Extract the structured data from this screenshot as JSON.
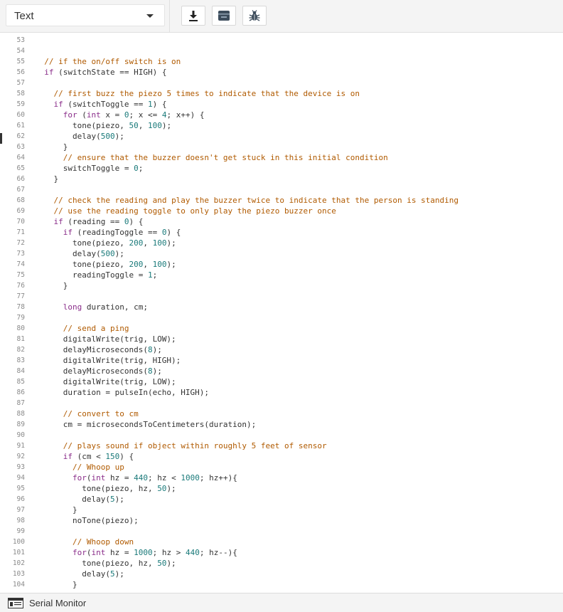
{
  "toolbar": {
    "mode_label": "Text",
    "icons": [
      "download-icon",
      "archive-icon",
      "bug-icon"
    ]
  },
  "colors": {
    "keyword": "#8a2d8a",
    "number": "#1a7a7a",
    "comment": "#b05a00",
    "text": "#333333",
    "gutter": "#8a8a8a"
  },
  "editor": {
    "first_visible_line": 53,
    "lines": [
      {
        "n": "53",
        "segs": []
      },
      {
        "n": "54",
        "segs": []
      },
      {
        "n": "55",
        "segs": [
          {
            "t": "  "
          },
          {
            "t": "// if the on/off switch is on",
            "c": "cm"
          }
        ]
      },
      {
        "n": "56",
        "segs": [
          {
            "t": "  "
          },
          {
            "t": "if",
            "c": "kw"
          },
          {
            "t": " (switchState == HIGH) {"
          }
        ]
      },
      {
        "n": "57",
        "segs": []
      },
      {
        "n": "58",
        "segs": [
          {
            "t": "    "
          },
          {
            "t": "// first buzz the piezo 5 times to indicate that the device is on",
            "c": "cm"
          }
        ]
      },
      {
        "n": "59",
        "segs": [
          {
            "t": "    "
          },
          {
            "t": "if",
            "c": "kw"
          },
          {
            "t": " (switchToggle == "
          },
          {
            "t": "1",
            "c": "num"
          },
          {
            "t": ") {"
          }
        ]
      },
      {
        "n": "60",
        "segs": [
          {
            "t": "      "
          },
          {
            "t": "for",
            "c": "kw"
          },
          {
            "t": " ("
          },
          {
            "t": "int",
            "c": "kw"
          },
          {
            "t": " x = "
          },
          {
            "t": "0",
            "c": "num"
          },
          {
            "t": "; x <= "
          },
          {
            "t": "4",
            "c": "num"
          },
          {
            "t": "; x++) {"
          }
        ]
      },
      {
        "n": "61",
        "segs": [
          {
            "t": "        tone(piezo, "
          },
          {
            "t": "50",
            "c": "num"
          },
          {
            "t": ", "
          },
          {
            "t": "100",
            "c": "num"
          },
          {
            "t": ");"
          }
        ]
      },
      {
        "n": "62",
        "segs": [
          {
            "t": "        delay("
          },
          {
            "t": "500",
            "c": "num"
          },
          {
            "t": ");"
          }
        ]
      },
      {
        "n": "63",
        "segs": [
          {
            "t": "      }"
          }
        ]
      },
      {
        "n": "64",
        "segs": [
          {
            "t": "      "
          },
          {
            "t": "// ensure that the buzzer doesn't get stuck in this initial condition",
            "c": "cm"
          }
        ]
      },
      {
        "n": "65",
        "segs": [
          {
            "t": "      switchToggle = "
          },
          {
            "t": "0",
            "c": "num"
          },
          {
            "t": ";"
          }
        ]
      },
      {
        "n": "66",
        "segs": [
          {
            "t": "    }"
          }
        ]
      },
      {
        "n": "67",
        "segs": []
      },
      {
        "n": "68",
        "segs": [
          {
            "t": "    "
          },
          {
            "t": "// check the reading and play the buzzer twice to indicate that the person is standing",
            "c": "cm"
          }
        ]
      },
      {
        "n": "69",
        "segs": [
          {
            "t": "    "
          },
          {
            "t": "// use the reading toggle to only play the piezo buzzer once",
            "c": "cm"
          }
        ]
      },
      {
        "n": "70",
        "segs": [
          {
            "t": "    "
          },
          {
            "t": "if",
            "c": "kw"
          },
          {
            "t": " (reading == "
          },
          {
            "t": "0",
            "c": "num"
          },
          {
            "t": ") {"
          }
        ]
      },
      {
        "n": "71",
        "segs": [
          {
            "t": "      "
          },
          {
            "t": "if",
            "c": "kw"
          },
          {
            "t": " (readingToggle == "
          },
          {
            "t": "0",
            "c": "num"
          },
          {
            "t": ") {"
          }
        ]
      },
      {
        "n": "72",
        "segs": [
          {
            "t": "        tone(piezo, "
          },
          {
            "t": "200",
            "c": "num"
          },
          {
            "t": ", "
          },
          {
            "t": "100",
            "c": "num"
          },
          {
            "t": ");"
          }
        ]
      },
      {
        "n": "73",
        "segs": [
          {
            "t": "        delay("
          },
          {
            "t": "500",
            "c": "num"
          },
          {
            "t": ");"
          }
        ]
      },
      {
        "n": "74",
        "segs": [
          {
            "t": "        tone(piezo, "
          },
          {
            "t": "200",
            "c": "num"
          },
          {
            "t": ", "
          },
          {
            "t": "100",
            "c": "num"
          },
          {
            "t": ");"
          }
        ]
      },
      {
        "n": "75",
        "segs": [
          {
            "t": "        readingToggle = "
          },
          {
            "t": "1",
            "c": "num"
          },
          {
            "t": ";"
          }
        ]
      },
      {
        "n": "76",
        "segs": [
          {
            "t": "      }"
          }
        ]
      },
      {
        "n": "77",
        "segs": []
      },
      {
        "n": "78",
        "segs": [
          {
            "t": "      "
          },
          {
            "t": "long",
            "c": "kw"
          },
          {
            "t": " duration, cm;"
          }
        ]
      },
      {
        "n": "79",
        "segs": []
      },
      {
        "n": "80",
        "segs": [
          {
            "t": "      "
          },
          {
            "t": "// send a ping",
            "c": "cm"
          }
        ]
      },
      {
        "n": "81",
        "segs": [
          {
            "t": "      digitalWrite(trig, LOW);"
          }
        ]
      },
      {
        "n": "82",
        "segs": [
          {
            "t": "      delayMicroseconds("
          },
          {
            "t": "8",
            "c": "num"
          },
          {
            "t": ");"
          }
        ]
      },
      {
        "n": "83",
        "segs": [
          {
            "t": "      digitalWrite(trig, HIGH);"
          }
        ]
      },
      {
        "n": "84",
        "segs": [
          {
            "t": "      delayMicroseconds("
          },
          {
            "t": "8",
            "c": "num"
          },
          {
            "t": ");"
          }
        ]
      },
      {
        "n": "85",
        "segs": [
          {
            "t": "      digitalWrite(trig, LOW);"
          }
        ]
      },
      {
        "n": "86",
        "segs": [
          {
            "t": "      duration = pulseIn(echo, HIGH);"
          }
        ]
      },
      {
        "n": "87",
        "segs": []
      },
      {
        "n": "88",
        "segs": [
          {
            "t": "      "
          },
          {
            "t": "// convert to cm",
            "c": "cm"
          }
        ]
      },
      {
        "n": "89",
        "segs": [
          {
            "t": "      cm = microsecondsToCentimeters(duration);"
          }
        ]
      },
      {
        "n": "90",
        "segs": []
      },
      {
        "n": "91",
        "segs": [
          {
            "t": "      "
          },
          {
            "t": "// plays sound if object within roughly 5 feet of sensor",
            "c": "cm"
          }
        ]
      },
      {
        "n": "92",
        "segs": [
          {
            "t": "      "
          },
          {
            "t": "if",
            "c": "kw"
          },
          {
            "t": " (cm < "
          },
          {
            "t": "150",
            "c": "num"
          },
          {
            "t": ") {"
          }
        ]
      },
      {
        "n": "93",
        "segs": [
          {
            "t": "        "
          },
          {
            "t": "// Whoop up",
            "c": "cm"
          }
        ]
      },
      {
        "n": "94",
        "segs": [
          {
            "t": "        "
          },
          {
            "t": "for",
            "c": "kw"
          },
          {
            "t": "("
          },
          {
            "t": "int",
            "c": "kw"
          },
          {
            "t": " hz = "
          },
          {
            "t": "440",
            "c": "num"
          },
          {
            "t": "; hz < "
          },
          {
            "t": "1000",
            "c": "num"
          },
          {
            "t": "; hz++){"
          }
        ]
      },
      {
        "n": "95",
        "segs": [
          {
            "t": "          tone(piezo, hz, "
          },
          {
            "t": "50",
            "c": "num"
          },
          {
            "t": ");"
          }
        ]
      },
      {
        "n": "96",
        "segs": [
          {
            "t": "          delay("
          },
          {
            "t": "5",
            "c": "num"
          },
          {
            "t": ");"
          }
        ]
      },
      {
        "n": "97",
        "segs": [
          {
            "t": "        }"
          }
        ]
      },
      {
        "n": "98",
        "segs": [
          {
            "t": "        noTone(piezo);"
          }
        ]
      },
      {
        "n": "99",
        "segs": []
      },
      {
        "n": "100",
        "segs": [
          {
            "t": "        "
          },
          {
            "t": "// Whoop down",
            "c": "cm"
          }
        ]
      },
      {
        "n": "101",
        "segs": [
          {
            "t": "        "
          },
          {
            "t": "for",
            "c": "kw"
          },
          {
            "t": "("
          },
          {
            "t": "int",
            "c": "kw"
          },
          {
            "t": " hz = "
          },
          {
            "t": "1000",
            "c": "num"
          },
          {
            "t": "; hz > "
          },
          {
            "t": "440",
            "c": "num"
          },
          {
            "t": "; hz--){"
          }
        ]
      },
      {
        "n": "102",
        "segs": [
          {
            "t": "          tone(piezo, hz, "
          },
          {
            "t": "50",
            "c": "num"
          },
          {
            "t": ");"
          }
        ]
      },
      {
        "n": "103",
        "segs": [
          {
            "t": "          delay("
          },
          {
            "t": "5",
            "c": "num"
          },
          {
            "t": ");"
          }
        ]
      },
      {
        "n": "104",
        "segs": [
          {
            "t": "        }"
          }
        ]
      }
    ]
  },
  "statusbar": {
    "serial_monitor_label": "Serial Monitor"
  }
}
